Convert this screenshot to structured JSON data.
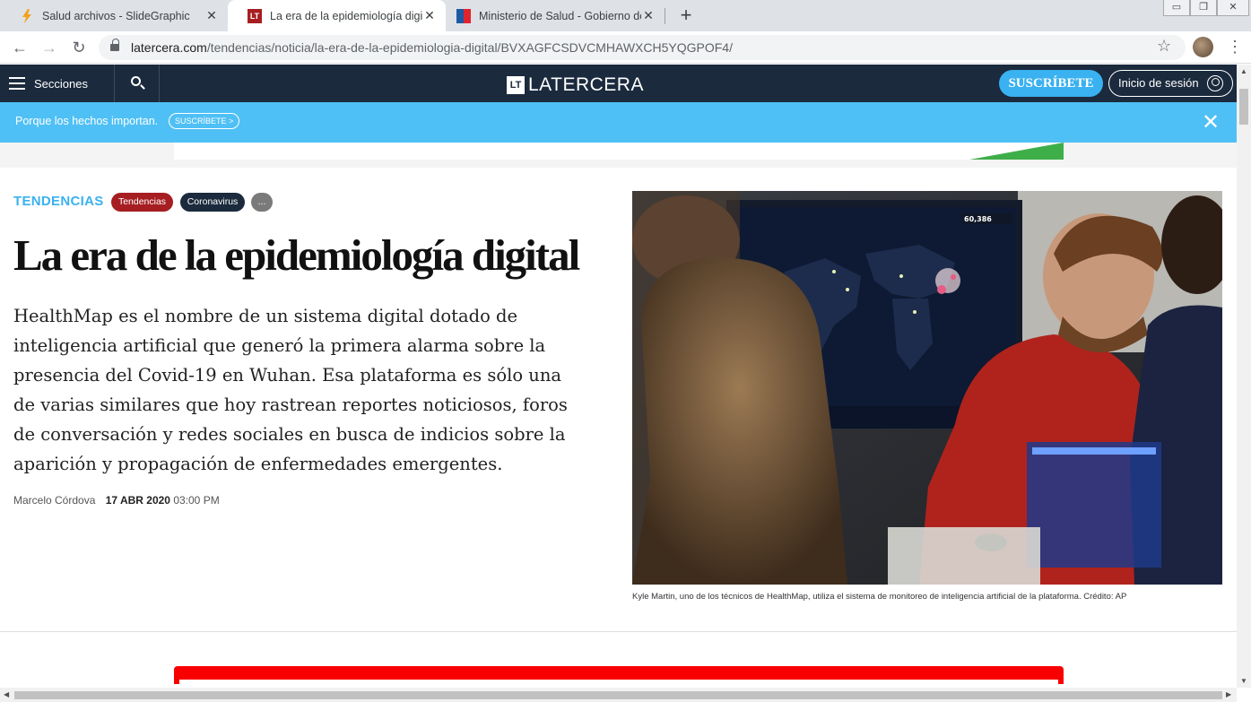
{
  "browser": {
    "tabs": [
      {
        "title": "Salud archivos - SlideGraphic",
        "favicon": "lightning-icon",
        "active": false
      },
      {
        "title": "La era de la epidemiología digital",
        "favicon": "lt-logo-icon",
        "active": true
      },
      {
        "title": "Ministerio de Salud - Gobierno de Chile",
        "favicon": "flag-icon",
        "active": false
      }
    ],
    "new_tab": "+",
    "url_host": "latercera.com",
    "url_path": "/tendencias/noticia/la-era-de-la-epidemiologia-digital/BVXAGFCSDVCMHAWXCH5YQGPOF4/"
  },
  "site": {
    "menu_label": "Secciones",
    "logo_mark": "LT",
    "logo_text": "LATERCERA",
    "subscribe_label": "SUSCRÍBETE",
    "login_label": "Inicio de sesión",
    "brand_navy": "#1b2a3d",
    "brand_blue": "#3ab1f0"
  },
  "promo": {
    "text": "Porque los hechos importan.",
    "pill": "SUSCRÍBETE >",
    "close": "✕"
  },
  "article": {
    "kicker": "TENDENCIAS",
    "tags": [
      {
        "label": "Tendencias",
        "color": "#a61e22"
      },
      {
        "label": "Coronavirus",
        "color": "#1b2a3d"
      },
      {
        "label": "...",
        "color": "#7a7a7a"
      }
    ],
    "headline": "La era de la epidemiología digital",
    "lede": "HealthMap es el nombre de un sistema digital dotado de inteligencia artificial que generó la primera alarma sobre la presencia del Covid-19 en Wuhan. Esa plataforma es sólo una de varias similares que hoy rastrean reportes noticiosos, foros de conversación y redes sociales en busca de indicios sobre la aparición y propagación de enfermedades emergentes.",
    "author": "Marcelo Córdova",
    "date": "17 ABR 2020",
    "time": "03:00 PM",
    "photo_counter": "60,386",
    "caption": "Kyle Martin, uno de los técnicos de HealthMap, utiliza el sistema de monitoreo de inteligencia artificial de la plataforma. Crédito: AP"
  }
}
